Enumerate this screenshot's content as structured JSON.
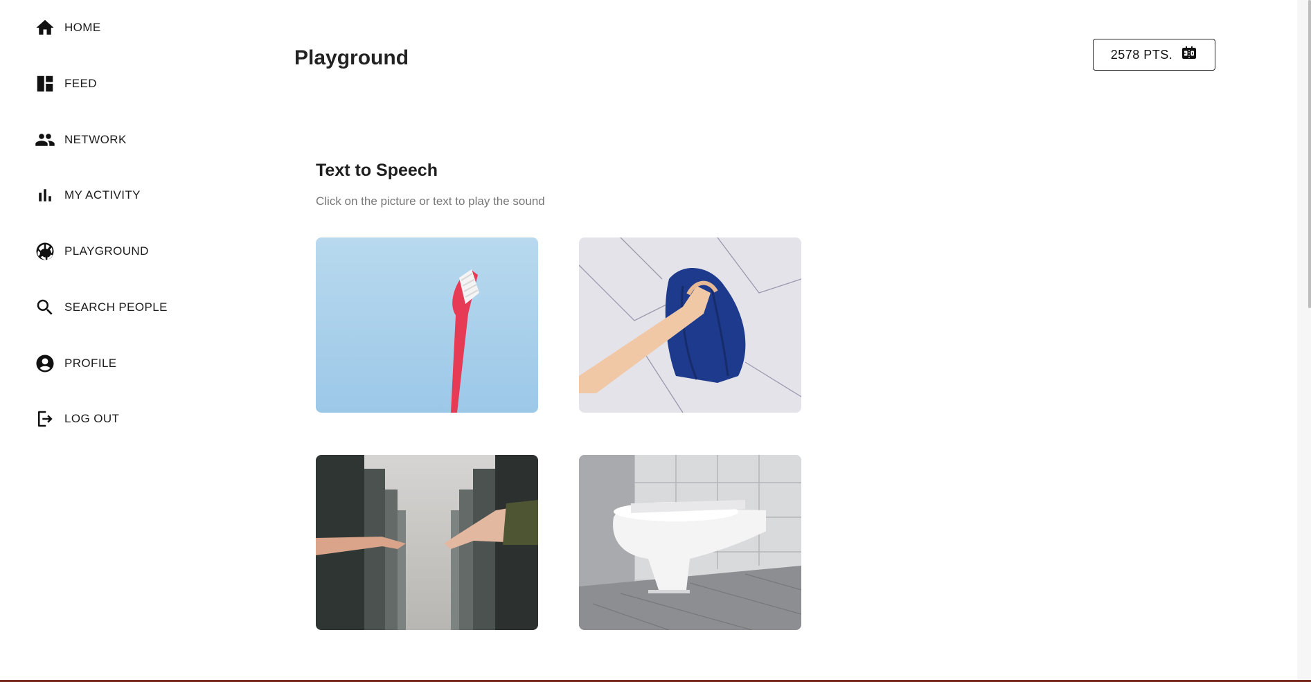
{
  "sidebar": {
    "items": [
      {
        "label": "HOME",
        "icon": "home-icon"
      },
      {
        "label": "FEED",
        "icon": "dashboard-icon"
      },
      {
        "label": "NETWORK",
        "icon": "people-icon"
      },
      {
        "label": "MY ACTIVITY",
        "icon": "bar-chart-icon"
      },
      {
        "label": "PLAYGROUND",
        "icon": "volleyball-icon"
      },
      {
        "label": "SEARCH PEOPLE",
        "icon": "search-icon"
      },
      {
        "label": "PROFILE",
        "icon": "account-circle-icon"
      },
      {
        "label": "LOG OUT",
        "icon": "logout-icon"
      }
    ]
  },
  "header": {
    "title": "Playground",
    "points_label": "2578 PTS.",
    "points_icon": "scoreboard-icon"
  },
  "section": {
    "title": "Text to Speech",
    "subtitle": "Click on the picture or text to play the sound"
  },
  "cards": [
    {
      "image": "toothbrush"
    },
    {
      "image": "towel"
    },
    {
      "image": "hands-reaching"
    },
    {
      "image": "toilet"
    }
  ],
  "colors": {
    "border_bottom": "#7a2a1c",
    "subtitle": "#777777"
  }
}
